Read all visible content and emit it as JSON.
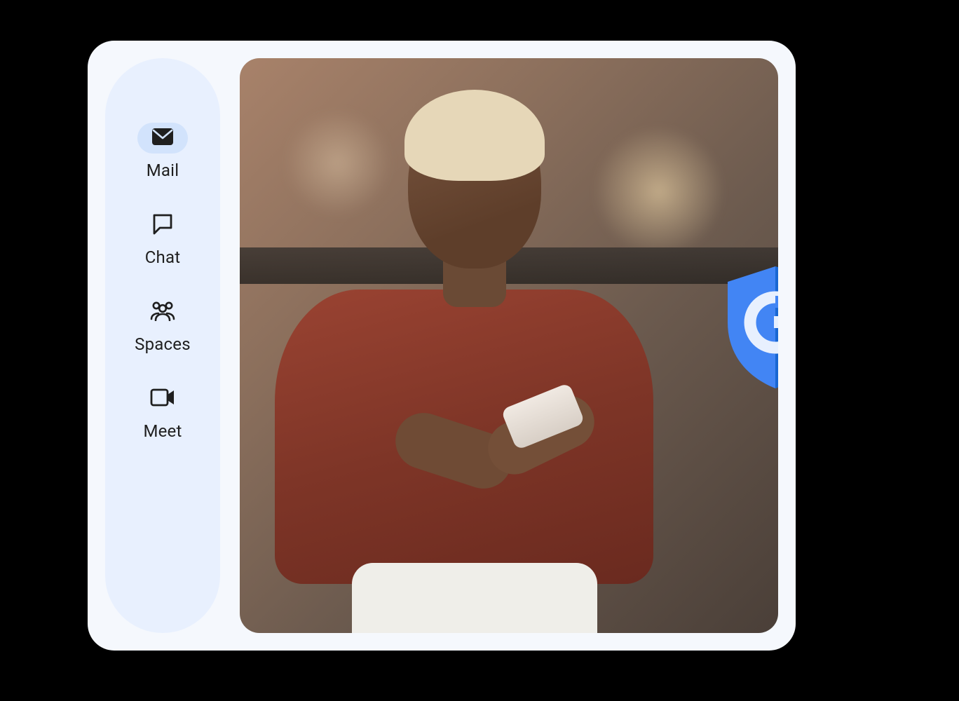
{
  "sidebar": {
    "items": [
      {
        "label": "Mail",
        "icon": "mail-icon",
        "selected": true
      },
      {
        "label": "Chat",
        "icon": "chat-icon",
        "selected": false
      },
      {
        "label": "Spaces",
        "icon": "spaces-icon",
        "selected": false
      },
      {
        "label": "Meet",
        "icon": "meet-icon",
        "selected": false
      }
    ]
  },
  "badge": {
    "icon": "google-shield-icon",
    "letter": "G"
  },
  "colors": {
    "card_bg": "#f5f8fd",
    "sidebar_bg": "#e8f0fe",
    "sidebar_pill": "#d2e3fc",
    "shield_blue_light": "#4285f4",
    "shield_blue_dark": "#1967d2"
  }
}
